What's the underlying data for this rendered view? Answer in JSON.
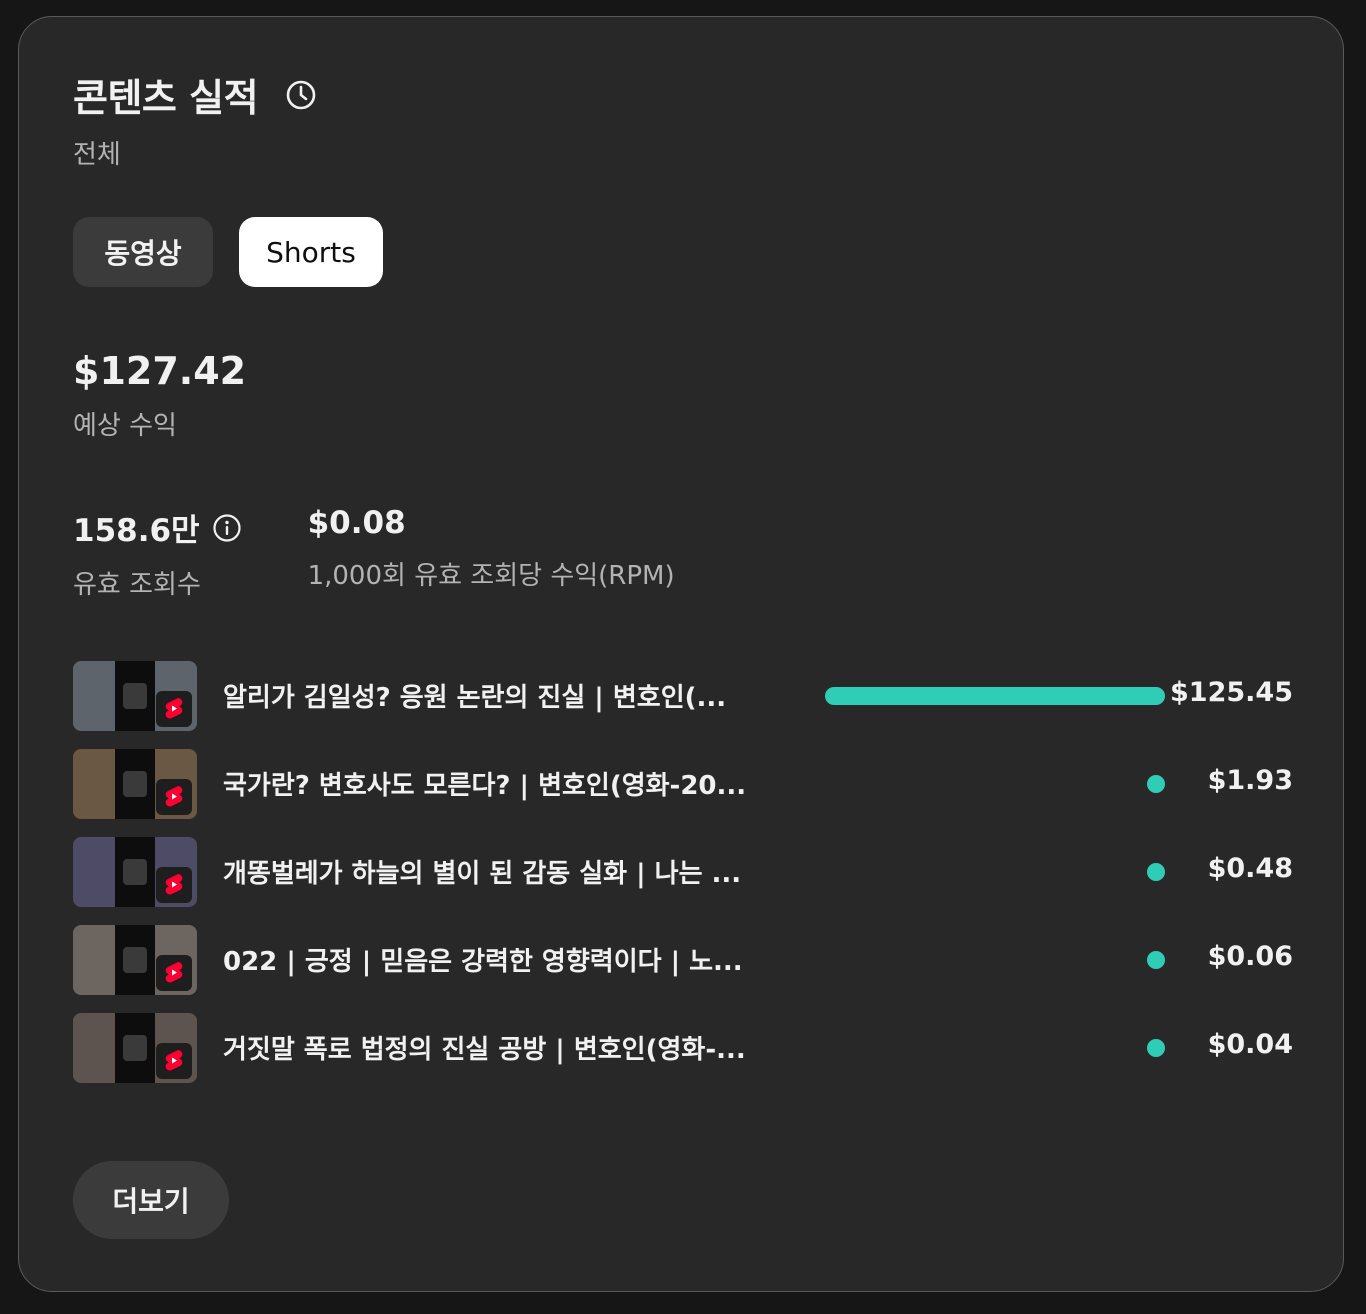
{
  "header": {
    "title": "콘텐츠 실적",
    "subtitle": "전체",
    "history_icon": "clock-icon"
  },
  "tabs": [
    {
      "label": "동영상",
      "selected": false
    },
    {
      "label": "Shorts",
      "selected": true
    }
  ],
  "revenue": {
    "value": "$127.42",
    "label": "예상 수익"
  },
  "metrics": [
    {
      "value": "158.6만",
      "label": "유효 조회수",
      "icon": "info-icon"
    },
    {
      "value": "$0.08",
      "label": "1,000회 유효 조회당 수익(RPM)"
    }
  ],
  "colors": {
    "accent": "#2fcdb6",
    "card_background": "#282828",
    "shorts_logo": "#ff0033"
  },
  "content_rows": [
    {
      "title": "알리가 김일성? 응원 논란의 진실 | 변호인(...",
      "value": "$125.45",
      "amount": 125.45,
      "thumb_color": "#5d646c"
    },
    {
      "title": "국가란? 변호사도 모른다? | 변호인(영화-20...",
      "value": "$1.93",
      "amount": 1.93,
      "thumb_color": "#6b5844"
    },
    {
      "title": "개똥벌레가 하늘의 별이 된 감동 실화 | 나는 ...",
      "value": "$0.48",
      "amount": 0.48,
      "thumb_color": "#4d4b66"
    },
    {
      "title": "022 | 긍정 | 믿음은 강력한 영향력이다 | 노...",
      "value": "$0.06",
      "amount": 0.06,
      "thumb_color": "#6d6560"
    },
    {
      "title": "거짓말 폭로 법정의 진실 공방 | 변호인(영화-...",
      "value": "$0.04",
      "amount": 0.04,
      "thumb_color": "#5e544f"
    }
  ],
  "more_button": {
    "label": "더보기"
  }
}
